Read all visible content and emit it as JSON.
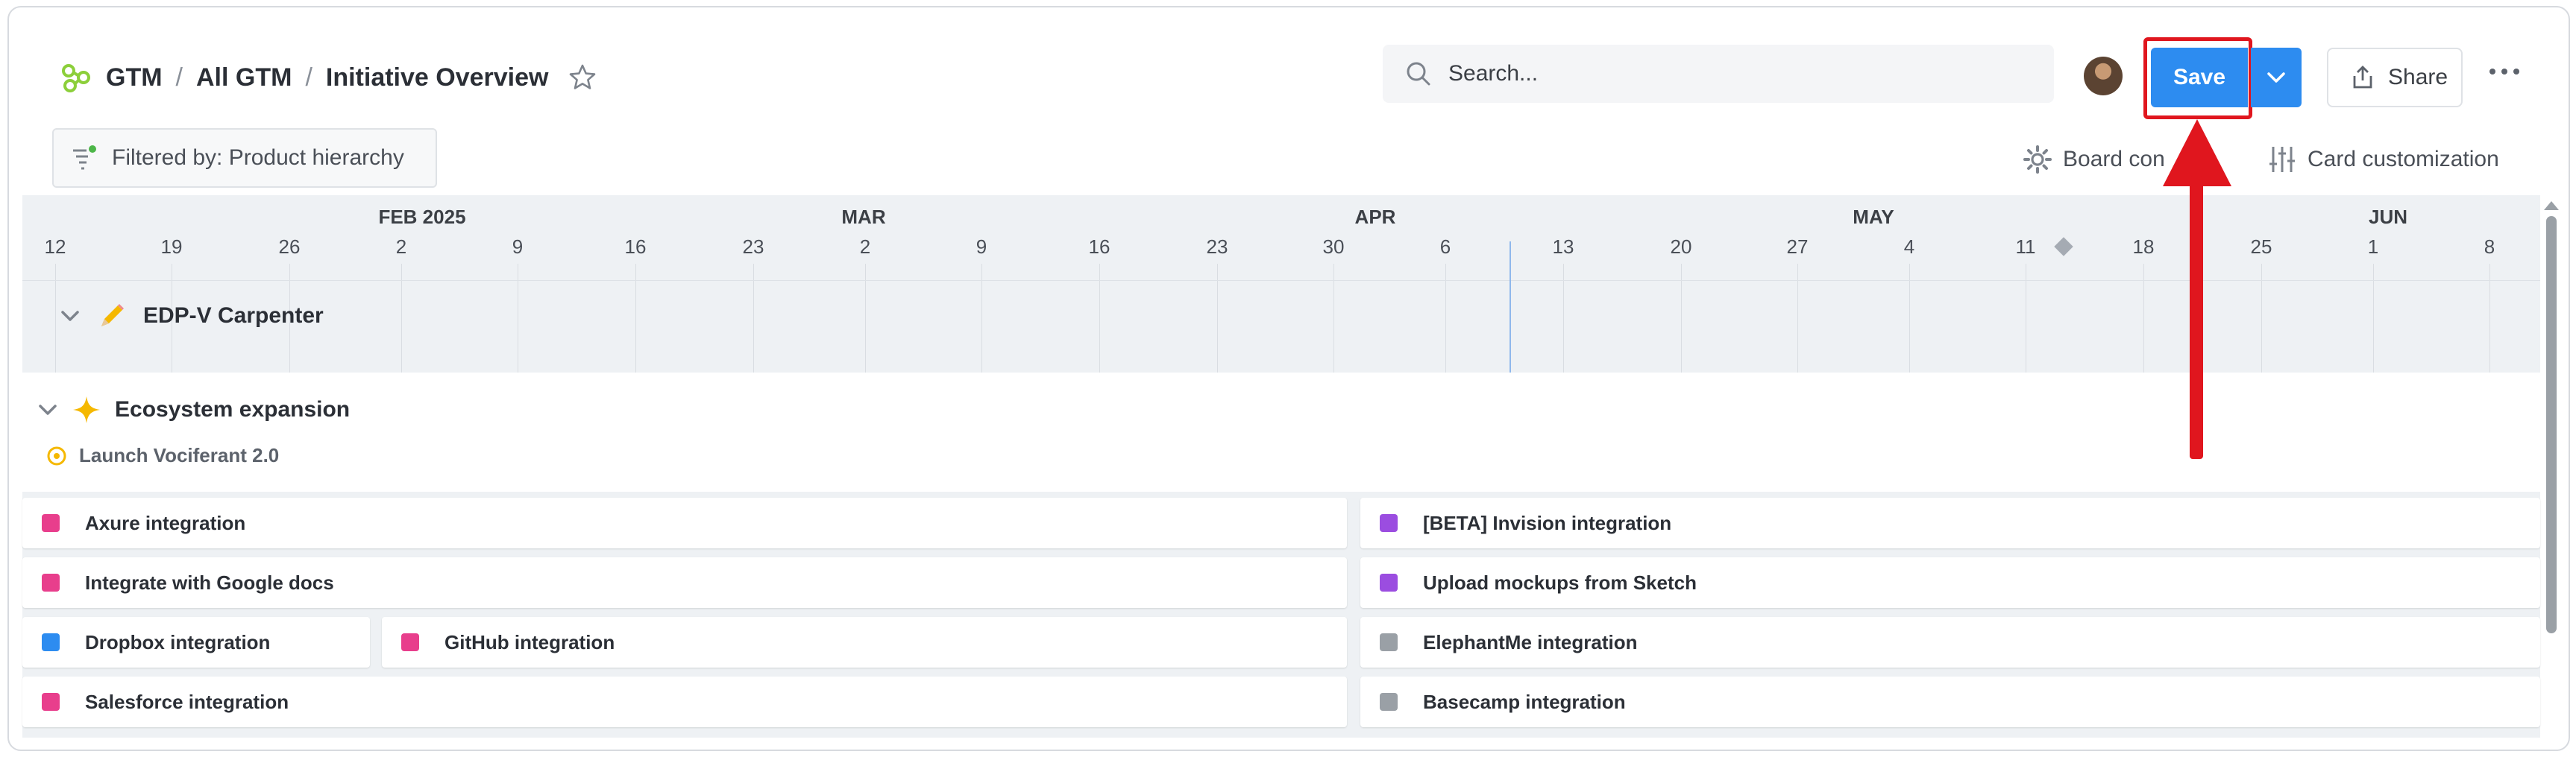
{
  "breadcrumb": {
    "items": [
      "GTM",
      "All GTM",
      "Initiative Overview"
    ],
    "separator": "/"
  },
  "search": {
    "placeholder": "Search..."
  },
  "toolbar": {
    "save_label": "Save",
    "share_label": "Share",
    "filter_label": "Filtered by: Product hierarchy",
    "board_config_label": "Board con",
    "card_customization_label": "Card customization"
  },
  "colors": {
    "accent": "#2d8cf0",
    "annotation": "#e0161e",
    "pink": "#e83e8c",
    "purple": "#9b4de0",
    "blue": "#2d8cf0",
    "gray": "#9aa0a6",
    "gold": "#f5b800"
  },
  "timeline": {
    "months": [
      "FEB 2025",
      "MAR",
      "APR",
      "MAY",
      "JUN"
    ],
    "days": [
      "12",
      "19",
      "26",
      "2",
      "9",
      "16",
      "23",
      "2",
      "9",
      "16",
      "23",
      "30",
      "6",
      "13",
      "20",
      "27",
      "4",
      "11",
      "18",
      "25",
      "1",
      "8"
    ]
  },
  "group": {
    "title": "EDP-V Carpenter",
    "icon": "pencil-icon"
  },
  "initiative": {
    "title": "Ecosystem expansion",
    "icon": "sparkle-icon",
    "subtitle": "Launch Vociferant 2.0",
    "subtitle_icon": "target-icon"
  },
  "cards": [
    {
      "label": "Axure integration",
      "color": "pink"
    },
    {
      "label": "[BETA] Invision integration",
      "color": "purple"
    },
    {
      "label": "Integrate with Google docs",
      "color": "pink"
    },
    {
      "label": "Upload mockups from Sketch",
      "color": "purple"
    },
    {
      "label": "Dropbox integration",
      "color": "blue"
    },
    {
      "label": "GitHub integration",
      "color": "pink"
    },
    {
      "label": "ElephantMe integration",
      "color": "gray"
    },
    {
      "label": "Salesforce integration",
      "color": "pink"
    },
    {
      "label": "Basecamp integration",
      "color": "gray"
    }
  ]
}
